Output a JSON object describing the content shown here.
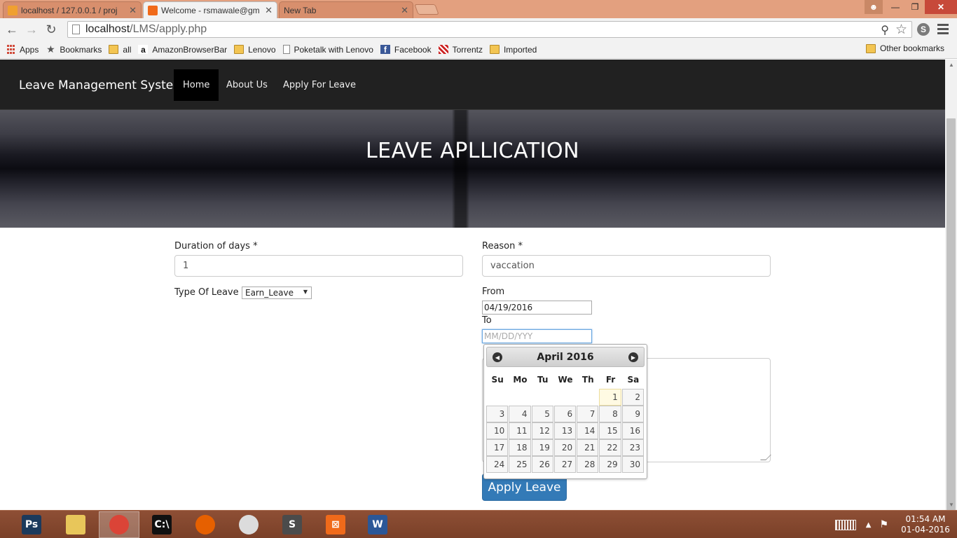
{
  "browser": {
    "tabs": [
      {
        "title": "localhost / 127.0.0.1 / proj",
        "favicon": "pma-icon",
        "color": "#f0a030"
      },
      {
        "title": "Welcome - rsmawale@gm",
        "favicon": "xampp-icon",
        "color": "#f06a1a"
      },
      {
        "title": "New Tab",
        "favicon": "",
        "color": ""
      }
    ],
    "url_host": "localhost",
    "url_path": "/LMS/apply.php",
    "bookmarks": [
      {
        "label": "Apps",
        "icon": "apps-icon"
      },
      {
        "label": "Bookmarks",
        "icon": "star-icon"
      },
      {
        "label": "all",
        "icon": "folder-icon"
      },
      {
        "label": "AmazonBrowserBar",
        "icon": "amazon-icon"
      },
      {
        "label": "Lenovo",
        "icon": "folder-icon"
      },
      {
        "label": "Poketalk with Lenovo",
        "icon": "page-icon"
      },
      {
        "label": "Facebook",
        "icon": "facebook-icon"
      },
      {
        "label": "Torrentz",
        "icon": "torrentz-icon"
      },
      {
        "label": "Imported",
        "icon": "folder-icon"
      }
    ],
    "other_bookmarks": "Other bookmarks"
  },
  "site": {
    "brand": "Leave Management System",
    "nav": [
      {
        "label": "Home",
        "active": true
      },
      {
        "label": "About Us",
        "active": false
      },
      {
        "label": "Apply For Leave",
        "active": false
      }
    ],
    "hero_title": "LEAVE APLLICATION"
  },
  "form": {
    "duration_label": "Duration of days *",
    "duration_value": "1",
    "reason_label": "Reason *",
    "reason_value": "vaccation",
    "type_label": "Type Of Leave *",
    "type_selected": "Earn_Leave",
    "from_label": "From",
    "from_value": "04/19/2016",
    "to_label": "To",
    "to_placeholder": "MM/DD/YYY",
    "submit_label": "Apply Leave"
  },
  "datepicker": {
    "month": "April",
    "year": "2016",
    "weekdays": [
      "Su",
      "Mo",
      "Tu",
      "We",
      "Th",
      "Fr",
      "Sa"
    ],
    "first_weekday_index": 5,
    "days": 30,
    "highlighted_day": 1
  },
  "taskbar": {
    "apps": [
      {
        "name": "photoshop-icon",
        "label": "Ps",
        "color": "#1b3a5c"
      },
      {
        "name": "file-explorer-icon",
        "label": "",
        "color": "#e8c65a"
      },
      {
        "name": "chrome-icon",
        "label": "",
        "color": "#db4437"
      },
      {
        "name": "command-prompt-icon",
        "label": "C:\\",
        "color": "#111111"
      },
      {
        "name": "firefox-icon",
        "label": "",
        "color": "#e66000"
      },
      {
        "name": "snipping-tool-icon",
        "label": "",
        "color": "#dcdcdc"
      },
      {
        "name": "sublime-text-icon",
        "label": "S",
        "color": "#4b4b4b"
      },
      {
        "name": "xampp-icon",
        "label": "⊠",
        "color": "#f06a1a"
      },
      {
        "name": "word-icon",
        "label": "W",
        "color": "#2b5797"
      }
    ],
    "active_index": 2,
    "time": "01:54 AM",
    "date": "01-04-2016"
  }
}
